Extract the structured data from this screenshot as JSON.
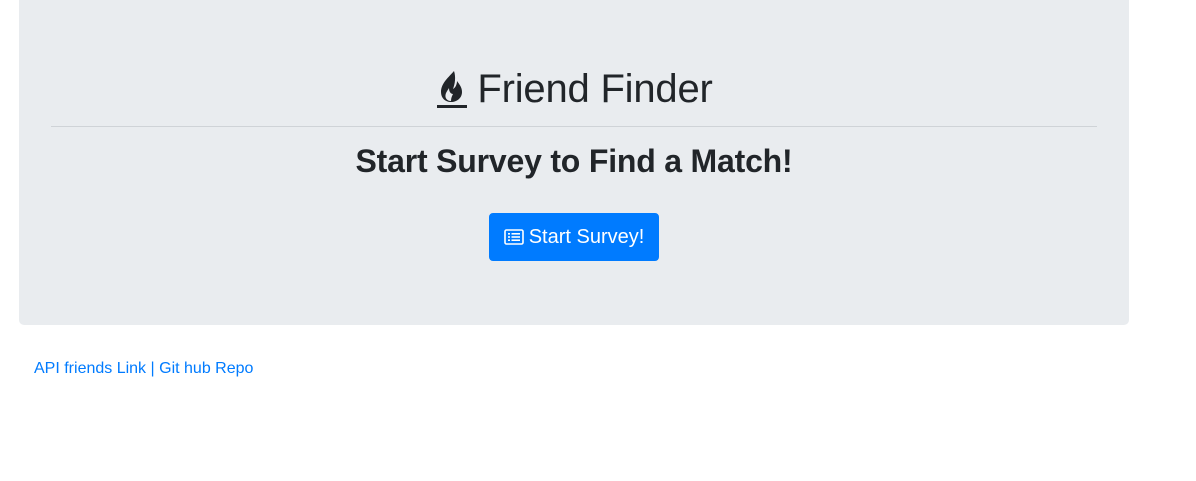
{
  "header": {
    "icon": "fire-icon",
    "title": "Friend Finder",
    "subtitle": "Start Survey to Find a Match!"
  },
  "survey_button": {
    "icon": "list-alt-icon",
    "label": "Start Survey!"
  },
  "footer": {
    "api_link_label": "API friends Link",
    "separator": "|",
    "repo_link_label": "Git hub Repo"
  },
  "colors": {
    "jumbotron_background": "#e9ecef",
    "primary": "#007bff",
    "text": "#212529"
  }
}
